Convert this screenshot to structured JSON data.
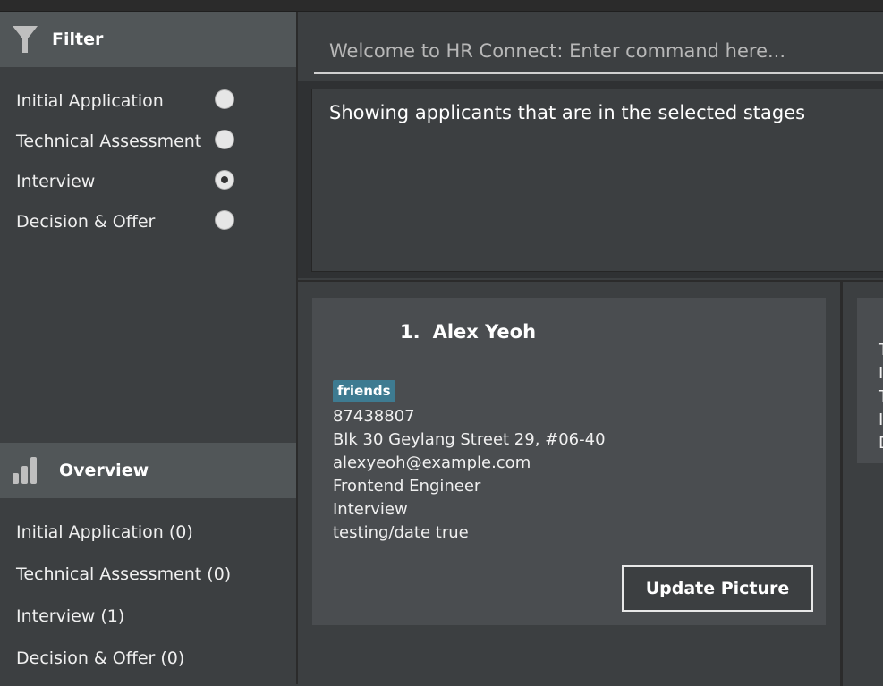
{
  "filter": {
    "title": "Filter",
    "icon": "funnel-icon",
    "options": [
      {
        "label": "Initial Application",
        "selected": false
      },
      {
        "label": "Technical Assessment",
        "selected": false
      },
      {
        "label": "Interview",
        "selected": true
      },
      {
        "label": "Decision & Offer",
        "selected": false
      }
    ]
  },
  "overview": {
    "title": "Overview",
    "icon": "bar-chart-icon",
    "items": [
      "Initial Application (0)",
      "Technical Assessment (0)",
      "Interview (1)",
      "Decision & Offer (0)"
    ]
  },
  "command": {
    "placeholder": "Welcome to HR Connect: Enter command here...",
    "value": ""
  },
  "result": {
    "text": "Showing applicants that are in the selected stages"
  },
  "applicants": [
    {
      "index": "1.",
      "name": "Alex Yeoh",
      "tag": "friends",
      "phone": "87438807",
      "address": "Blk 30 Geylang Street 29, #06-40",
      "email": "alexyeoh@example.com",
      "position": "Frontend Engineer",
      "stage": "Interview",
      "note": "testing/date true",
      "button_label": "Update Picture"
    }
  ],
  "partial_card": {
    "chars": [
      "T",
      "I",
      "T",
      "I",
      "D"
    ]
  },
  "colors": {
    "tag_bg": "#3e7b91",
    "card_bg": "#4a4d50",
    "background": "#3c3f41"
  }
}
